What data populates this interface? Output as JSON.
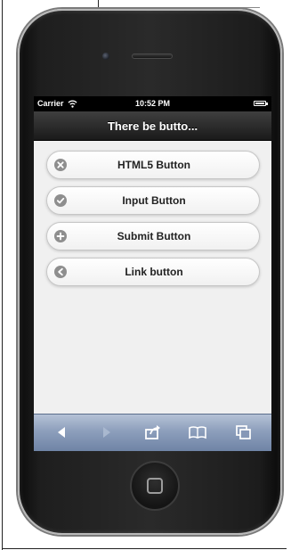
{
  "status_bar": {
    "carrier": "Carrier",
    "time": "10:52 PM"
  },
  "header": {
    "title": "There be butto..."
  },
  "buttons": [
    {
      "label": "HTML5 Button",
      "icon": "delete-icon"
    },
    {
      "label": "Input Button",
      "icon": "check-icon"
    },
    {
      "label": "Submit Button",
      "icon": "plus-icon"
    },
    {
      "label": "Link button",
      "icon": "arrow-left-icon"
    }
  ],
  "toolbar": {
    "items": [
      "back-icon",
      "forward-icon",
      "share-icon",
      "bookmarks-icon",
      "tabs-icon"
    ]
  },
  "colors": {
    "toolbar": "#8d9fbc",
    "header": "#1a1a1a",
    "content_background": "#f0f0f0"
  }
}
